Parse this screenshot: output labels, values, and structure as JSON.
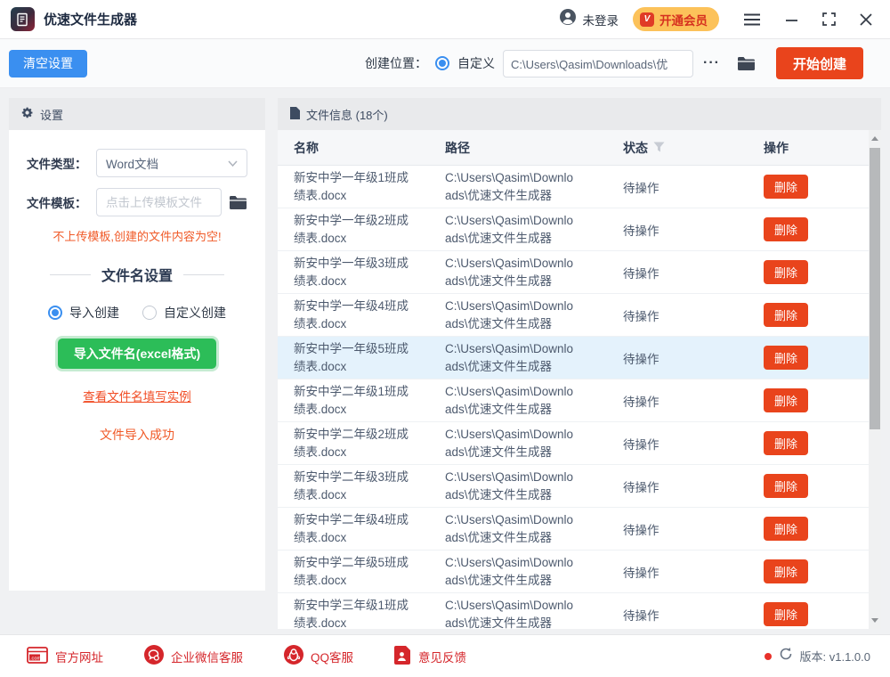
{
  "titlebar": {
    "app_title": "优速文件生成器",
    "login_status": "未登录",
    "vip_icon_letter": "V",
    "vip_button_label": "开通会员"
  },
  "toolbar": {
    "clear_button": "清空设置",
    "location_label": "创建位置：",
    "location_option": "自定义",
    "path_value": "C:\\Users\\Qasim\\Downloads\\优",
    "ellipsis_button": "···",
    "create_button": "开始创建"
  },
  "settings_panel": {
    "header": "设置",
    "file_type_label": "文件类型：",
    "file_type_value": "Word文档",
    "template_label": "文件模板：",
    "template_placeholder": "点击上传模板文件",
    "warning_text": "不上传模板,创建的文件内容为空!",
    "filename_heading": "文件名设置",
    "radio_import_label": "导入创建",
    "radio_custom_label": "自定义创建",
    "import_button": "导入文件名(excel格式)",
    "example_link": "查看文件名填写实例",
    "status_message": "文件导入成功"
  },
  "file_panel": {
    "header": "文件信息 (18个)",
    "columns": {
      "name": "名称",
      "path": "路径",
      "status": "状态",
      "action": "操作"
    },
    "delete_button": "删除",
    "rows": [
      {
        "name": "新安中学一年级1班成绩表.docx",
        "path": "C:\\Users\\Qasim\\Downloads\\优速文件生成器",
        "status": "待操作",
        "highlighted": false
      },
      {
        "name": "新安中学一年级2班成绩表.docx",
        "path": "C:\\Users\\Qasim\\Downloads\\优速文件生成器",
        "status": "待操作",
        "highlighted": false
      },
      {
        "name": "新安中学一年级3班成绩表.docx",
        "path": "C:\\Users\\Qasim\\Downloads\\优速文件生成器",
        "status": "待操作",
        "highlighted": false
      },
      {
        "name": "新安中学一年级4班成绩表.docx",
        "path": "C:\\Users\\Qasim\\Downloads\\优速文件生成器",
        "status": "待操作",
        "highlighted": false
      },
      {
        "name": "新安中学一年级5班成绩表.docx",
        "path": "C:\\Users\\Qasim\\Downloads\\优速文件生成器",
        "status": "待操作",
        "highlighted": true
      },
      {
        "name": "新安中学二年级1班成绩表.docx",
        "path": "C:\\Users\\Qasim\\Downloads\\优速文件生成器",
        "status": "待操作",
        "highlighted": false
      },
      {
        "name": "新安中学二年级2班成绩表.docx",
        "path": "C:\\Users\\Qasim\\Downloads\\优速文件生成器",
        "status": "待操作",
        "highlighted": false
      },
      {
        "name": "新安中学二年级3班成绩表.docx",
        "path": "C:\\Users\\Qasim\\Downloads\\优速文件生成器",
        "status": "待操作",
        "highlighted": false
      },
      {
        "name": "新安中学二年级4班成绩表.docx",
        "path": "C:\\Users\\Qasim\\Downloads\\优速文件生成器",
        "status": "待操作",
        "highlighted": false
      },
      {
        "name": "新安中学二年级5班成绩表.docx",
        "path": "C:\\Users\\Qasim\\Downloads\\优速文件生成器",
        "status": "待操作",
        "highlighted": false
      },
      {
        "name": "新安中学三年级1班成绩表.docx",
        "path": "C:\\Users\\Qasim\\Downloads\\优速文件生成器",
        "status": "待操作",
        "highlighted": false
      }
    ]
  },
  "footer": {
    "links": [
      "官方网址",
      "企业微信客服",
      "QQ客服",
      "意见反馈"
    ],
    "version": "版本: v1.1.0.0"
  },
  "colors": {
    "primary_blue": "#3a8ff0",
    "primary_orange": "#e9441c",
    "green": "#2cbd58",
    "vip_bg": "#fcc25a",
    "vip_text": "#d6301f",
    "warning_red": "#f05a28",
    "footer_red": "#d5262b",
    "row_highlight": "#e4f2fc"
  }
}
